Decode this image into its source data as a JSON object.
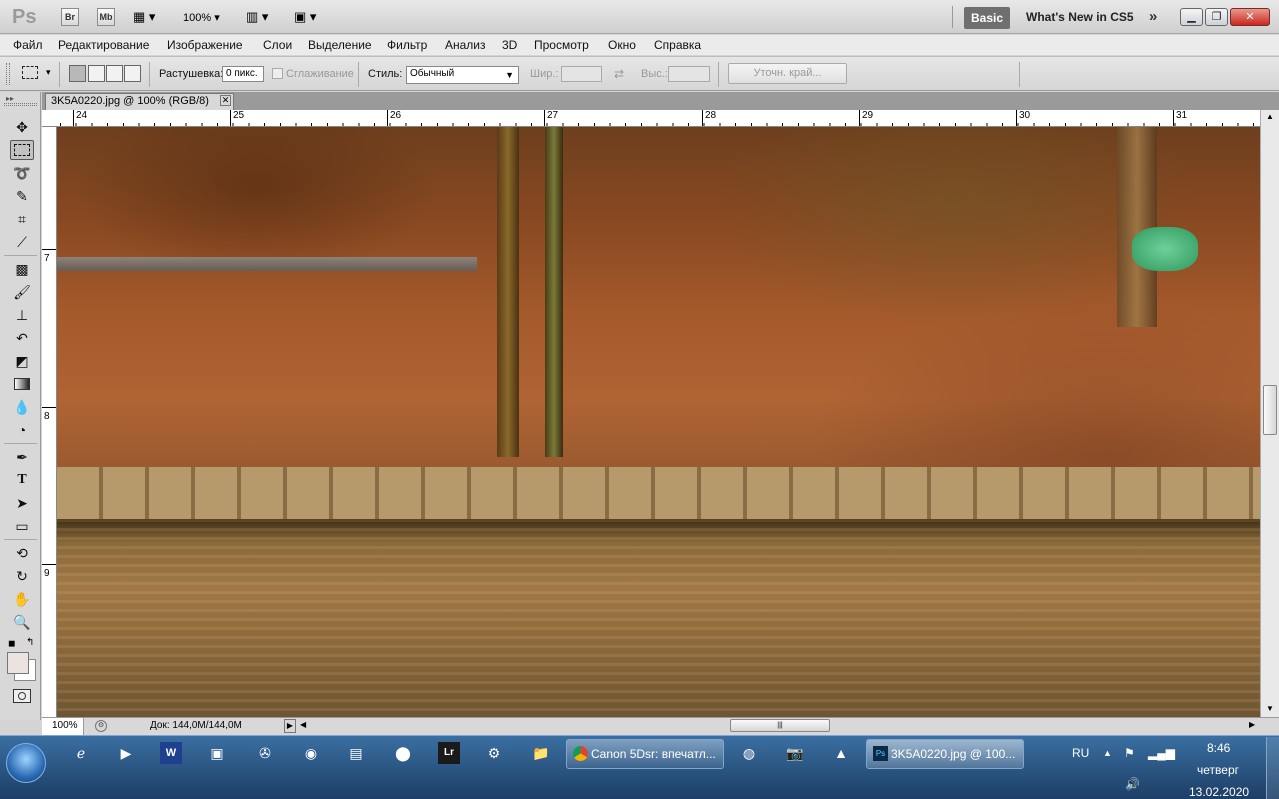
{
  "app": {
    "logo": "Ps",
    "bridge_label": "Br",
    "minibridge_label": "Mb",
    "zoom_menu": "100%",
    "workspace": "Basic",
    "whats_new": "What's New in CS5"
  },
  "menu": [
    "Файл",
    "Редактирование",
    "Изображение",
    "Слои",
    "Выделение",
    "Фильтр",
    "Анализ",
    "3D",
    "Просмотр",
    "Окно",
    "Справка"
  ],
  "options": {
    "feather_label": "Растушевка:",
    "feather_value": "0 пикс.",
    "antialias_label": "Сглаживание",
    "style_label": "Стиль:",
    "style_value": "Обычный",
    "width_label": "Шир.:",
    "height_label": "Выс.:",
    "refine_edge": "Уточн. край..."
  },
  "document": {
    "tab_title": "3K5A0220.jpg @ 100% (RGB/8)",
    "ruler_h": [
      "24",
      "25",
      "26",
      "27",
      "28",
      "29",
      "30",
      "31"
    ],
    "ruler_v": [
      "7",
      "8",
      "9"
    ]
  },
  "status": {
    "zoom": "100%",
    "doc_size": "Док: 144,0M/144,0M"
  },
  "taskbar": {
    "chrome_title": "Canon 5Dsr: впечатл...",
    "ps_title": "3K5A0220.jpg @ 100...",
    "lang": "RU",
    "time": "8:46",
    "day": "четверг",
    "date": "13.02.2020"
  },
  "tools": [
    "move-icon",
    "marquee-icon",
    "lasso-icon",
    "quick-select-icon",
    "crop-icon",
    "eyedropper-icon",
    "healing-icon",
    "brush-icon",
    "clone-stamp-icon",
    "history-brush-icon",
    "eraser-icon",
    "gradient-icon",
    "blur-icon",
    "dodge-icon",
    "pen-icon",
    "type-icon",
    "path-select-icon",
    "shape-icon",
    "3d-rotate-icon",
    "3d-orbit-icon",
    "hand-icon",
    "zoom-icon"
  ],
  "colors": {
    "foreground": "#ebe3df",
    "background": "#ffffff",
    "accent_workspace": "#6f6f6f",
    "close_button": "#d9342b"
  }
}
